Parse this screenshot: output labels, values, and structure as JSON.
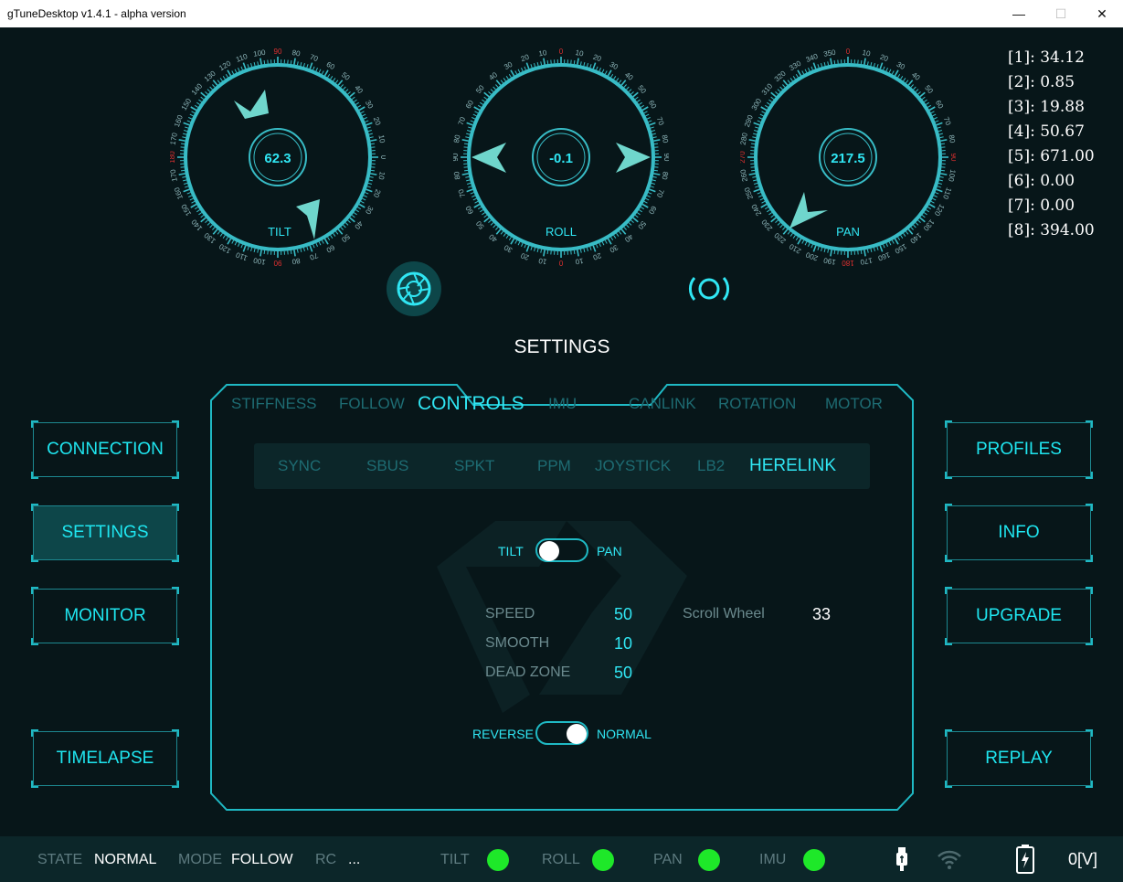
{
  "window": {
    "title": "gTuneDesktop  v1.4.1 - alpha version",
    "min": "—",
    "max": "☐",
    "close": "✕"
  },
  "dials": [
    {
      "name": "TILT",
      "value": "62.3"
    },
    {
      "name": "ROLL",
      "value": "-0.1"
    },
    {
      "name": "PAN",
      "value": "217.5"
    }
  ],
  "telemetry": [
    "[1]: 34.12",
    "[2]: 0.85",
    "[3]: 19.88",
    "[4]: 50.67",
    "[5]: 671.00",
    "[6]: 0.00",
    "[7]: 0.00",
    "[8]: 394.00"
  ],
  "left_nav": [
    "CONNECTION",
    "SETTINGS",
    "MONITOR",
    "TIMELAPSE"
  ],
  "right_nav": [
    "PROFILES",
    "INFO",
    "UPGRADE",
    "REPLAY"
  ],
  "settings": {
    "title": "SETTINGS",
    "tabs": [
      "STIFFNESS",
      "FOLLOW",
      "CONTROLS",
      "IMU",
      "CANLINK",
      "ROTATION",
      "MOTOR"
    ],
    "subtabs": [
      "SYNC",
      "SBUS",
      "SPKT",
      "PPM",
      "JOYSTICK",
      "LB2",
      "HERELINK"
    ],
    "axis_toggle": {
      "left": "TILT",
      "right": "PAN",
      "state": "TILT"
    },
    "params": {
      "speed_label": "SPEED",
      "speed": "50",
      "smooth_label": "SMOOTH",
      "smooth": "10",
      "deadzone_label": "DEAD ZONE",
      "deadzone": "50",
      "scroll_label": "Scroll Wheel",
      "scroll": "33"
    },
    "direction_toggle": {
      "left": "REVERSE",
      "right": "NORMAL",
      "state": "NORMAL"
    }
  },
  "status": {
    "state_label": "STATE",
    "state": "NORMAL",
    "mode_label": "MODE",
    "mode": "FOLLOW",
    "rc_label": "RC",
    "rc": "...",
    "leds": [
      "TILT",
      "ROLL",
      "PAN",
      "IMU"
    ],
    "voltage": "0[V]"
  },
  "colors": {
    "accent": "#30e6f3",
    "led": "#1ee829",
    "bg": "#071619",
    "marker": "#6fd6cc",
    "red_tick": "#e03030"
  }
}
